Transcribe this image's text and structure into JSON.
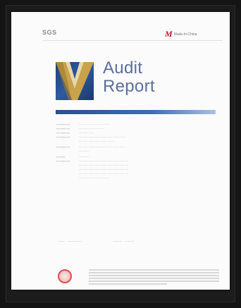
{
  "document": {
    "header_left": "SGS",
    "header_right_mark": "M",
    "header_right_text": "Made-in-China",
    "title_line1": "Audit",
    "title_line2": "Report"
  },
  "colors": {
    "accent_blue": "#2b4f90",
    "title_blue": "#5a6f9e",
    "brand_red": "#c8102e",
    "seal_red": "#d9534f"
  },
  "icons": [
    "audit-logo-icon",
    "seal-icon"
  ]
}
